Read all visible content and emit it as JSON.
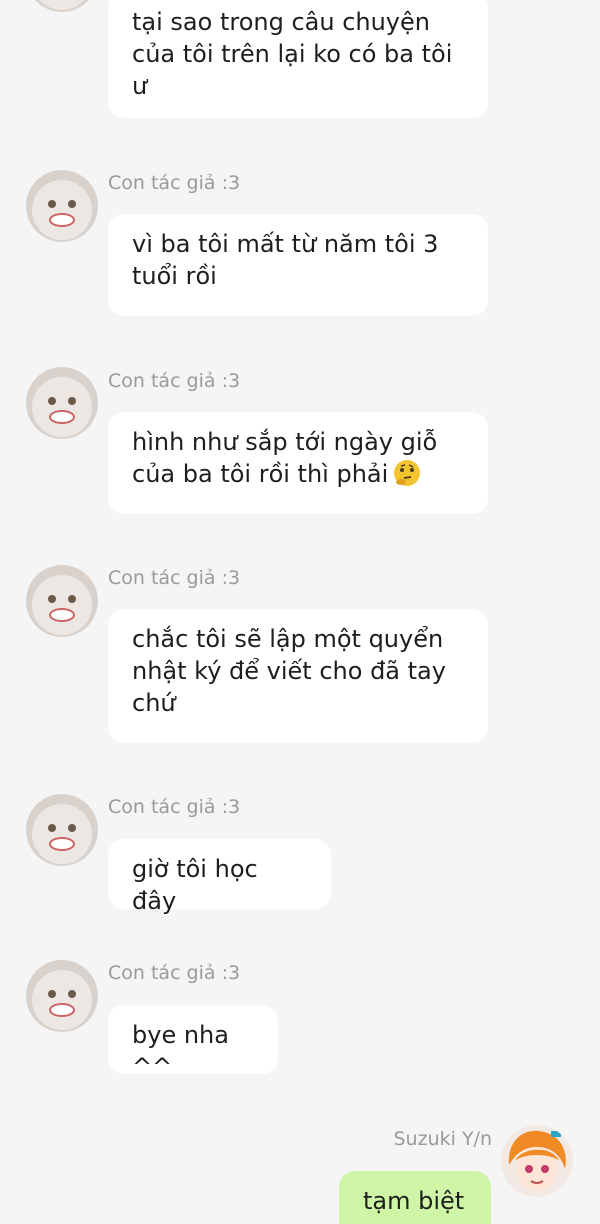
{
  "messages": [
    {
      "sender": "",
      "text": "tại sao trong câu chuyện của tôi trên lại ko có ba tôi ư"
    },
    {
      "sender": "Con tác giả :3",
      "text": "vì ba tôi mất từ năm tôi 3 tuổi rồi"
    },
    {
      "sender": "Con tác giả :3",
      "text": "hình như sắp tới ngày giỗ của ba tôi rồi thì phải",
      "emoji": "thinking-face-icon"
    },
    {
      "sender": "Con tác giả :3",
      "text": "chắc tôi sẽ lập một quyển nhật ký để viết cho đã tay chứ"
    },
    {
      "sender": "Con tác giả :3",
      "text": "giờ tôi học đây"
    },
    {
      "sender": "Con tác giả :3",
      "text": "bye nha ^^"
    },
    {
      "sender": "Suzuki Y/n",
      "text": "tạm biệt"
    }
  ],
  "colors": {
    "background": "#f5f5f5",
    "incoming_bubble": "#ffffff",
    "outgoing_bubble": "#cff5a6",
    "sender_name": "#9a9a9a"
  }
}
